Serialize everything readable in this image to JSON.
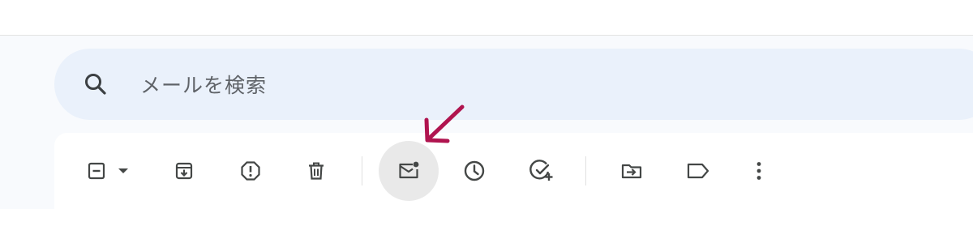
{
  "search": {
    "placeholder": "メールを検索",
    "icon": "search-icon"
  },
  "toolbar": {
    "buttons": [
      {
        "name": "select-checkbox-button",
        "icon": "checkbox-indeterminate-icon"
      },
      {
        "name": "select-dropdown-button",
        "icon": "caret-down-icon"
      },
      {
        "name": "archive-button",
        "icon": "archive-icon"
      },
      {
        "name": "report-spam-button",
        "icon": "report-spam-icon"
      },
      {
        "name": "delete-button",
        "icon": "trash-icon"
      },
      {
        "name": "mark-unread-button",
        "icon": "mark-unread-icon",
        "state": "hover"
      },
      {
        "name": "snooze-button",
        "icon": "clock-icon"
      },
      {
        "name": "add-to-tasks-button",
        "icon": "add-task-icon"
      },
      {
        "name": "move-to-button",
        "icon": "move-to-folder-icon"
      },
      {
        "name": "label-button",
        "icon": "label-icon"
      },
      {
        "name": "more-options-button",
        "icon": "more-vert-icon"
      }
    ]
  },
  "annotation": {
    "icon": "pointer-arrow-icon",
    "color": "#b0144f"
  },
  "colors": {
    "icon": "#444746",
    "search_bg": "#eaf1fb",
    "app_bg": "#f8fafd",
    "hover_bg": "#e9e9e9"
  }
}
